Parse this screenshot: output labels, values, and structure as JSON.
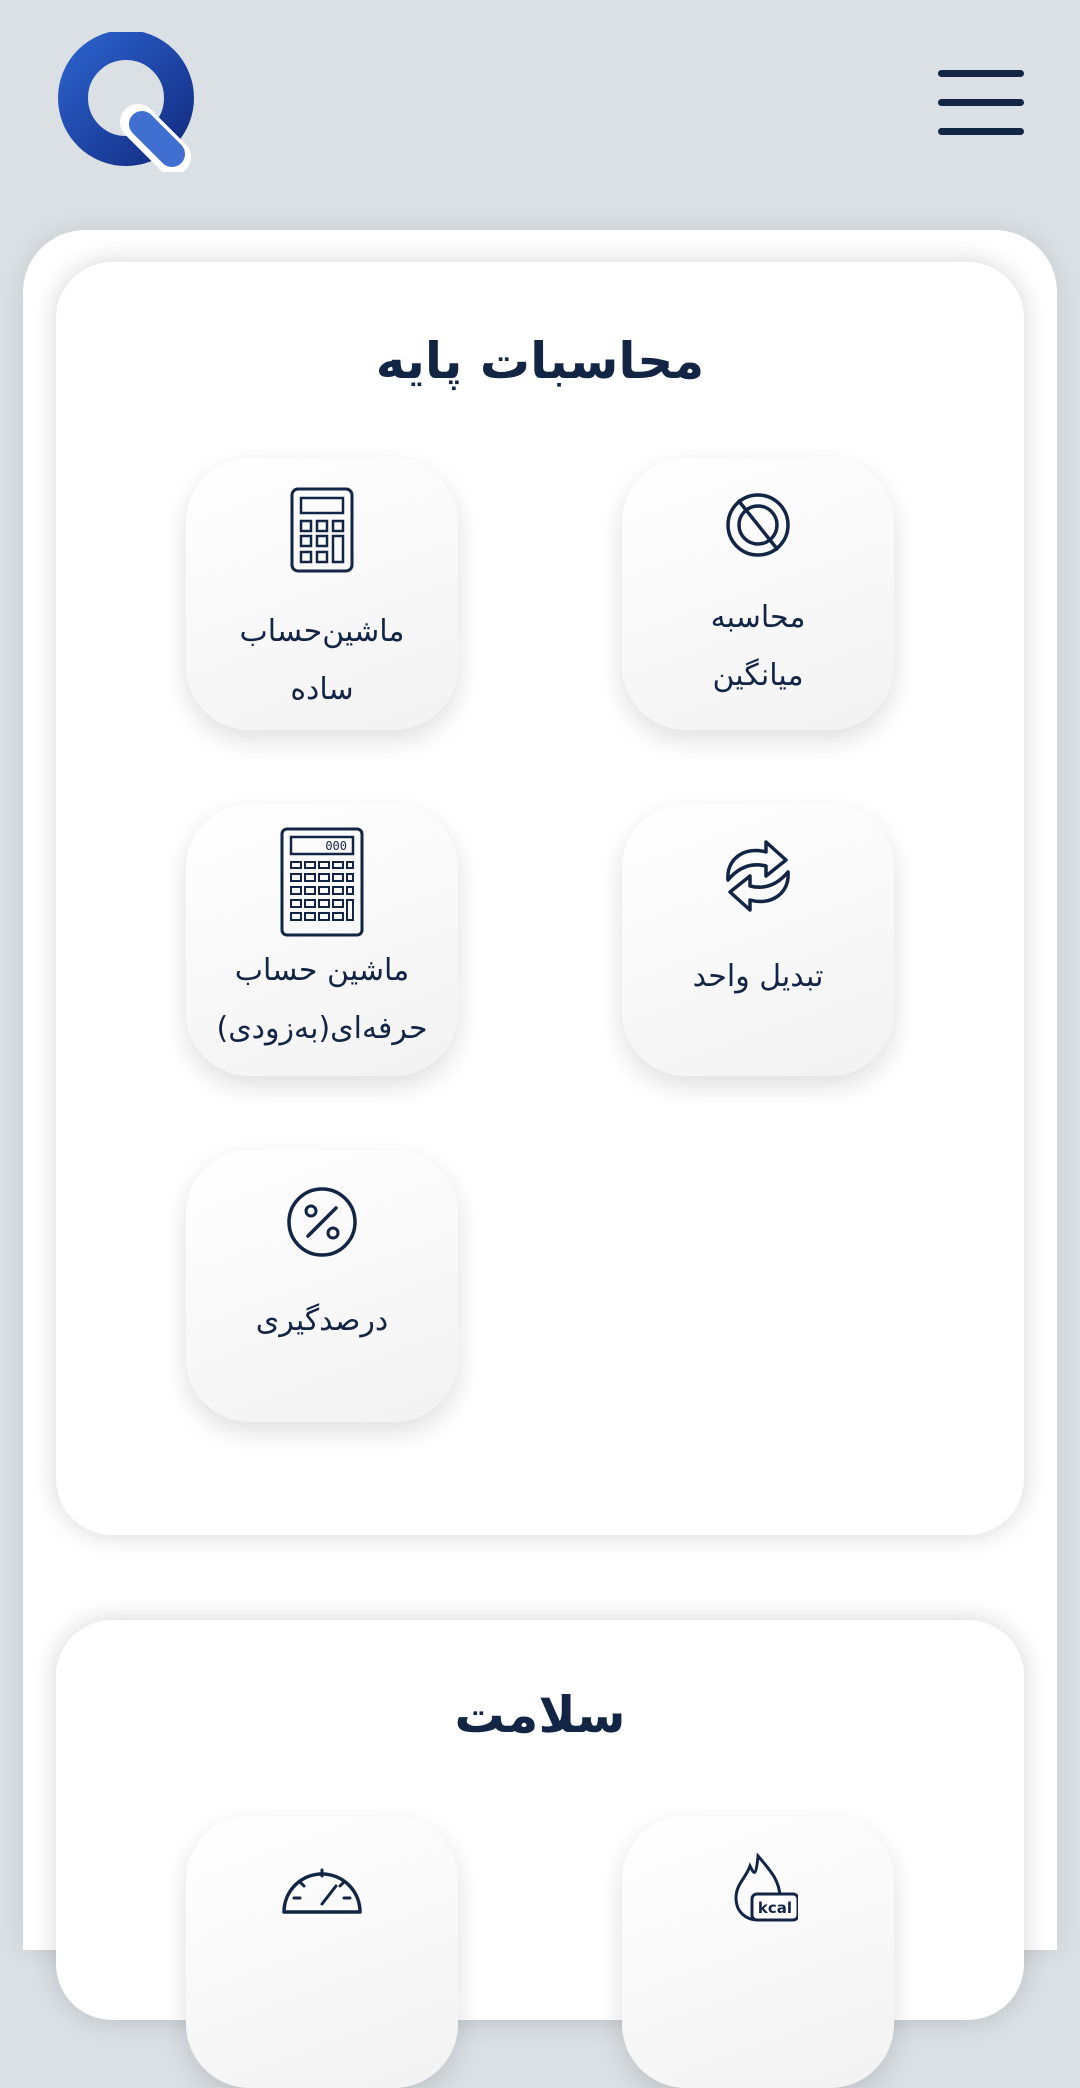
{
  "header": {
    "logo_icon": "q-logo",
    "menu_icon": "hamburger-menu-icon"
  },
  "colors": {
    "background": "#dbe0e4",
    "navy": "#132544",
    "logo_blue": "#2a55b8",
    "logo_dark_blue": "#1a3c97"
  },
  "sections": [
    {
      "title": "محاسبات پایه",
      "tiles": [
        {
          "icon": "no-average-icon",
          "label_line1": "محاسبه",
          "label_line2": "میانگین"
        },
        {
          "icon": "calculator-icon",
          "label_line1": "ماشین‌حساب",
          "label_line2": "ساده"
        },
        {
          "icon": "refresh-arrows-icon",
          "label_line1": "تبدیل واحد",
          "label_line2": ""
        },
        {
          "icon": "scientific-calculator-icon",
          "label_line1": "ماشین حساب",
          "label_line2": "حرفه‌ای(به‌زودی)"
        },
        {
          "icon": "percent-icon",
          "label_line1": "درصدگیری",
          "label_line2": ""
        }
      ]
    },
    {
      "title": "سلامت",
      "tiles": [
        {
          "icon": "kcal-flame-icon"
        },
        {
          "icon": "speedometer-icon"
        }
      ]
    }
  ]
}
